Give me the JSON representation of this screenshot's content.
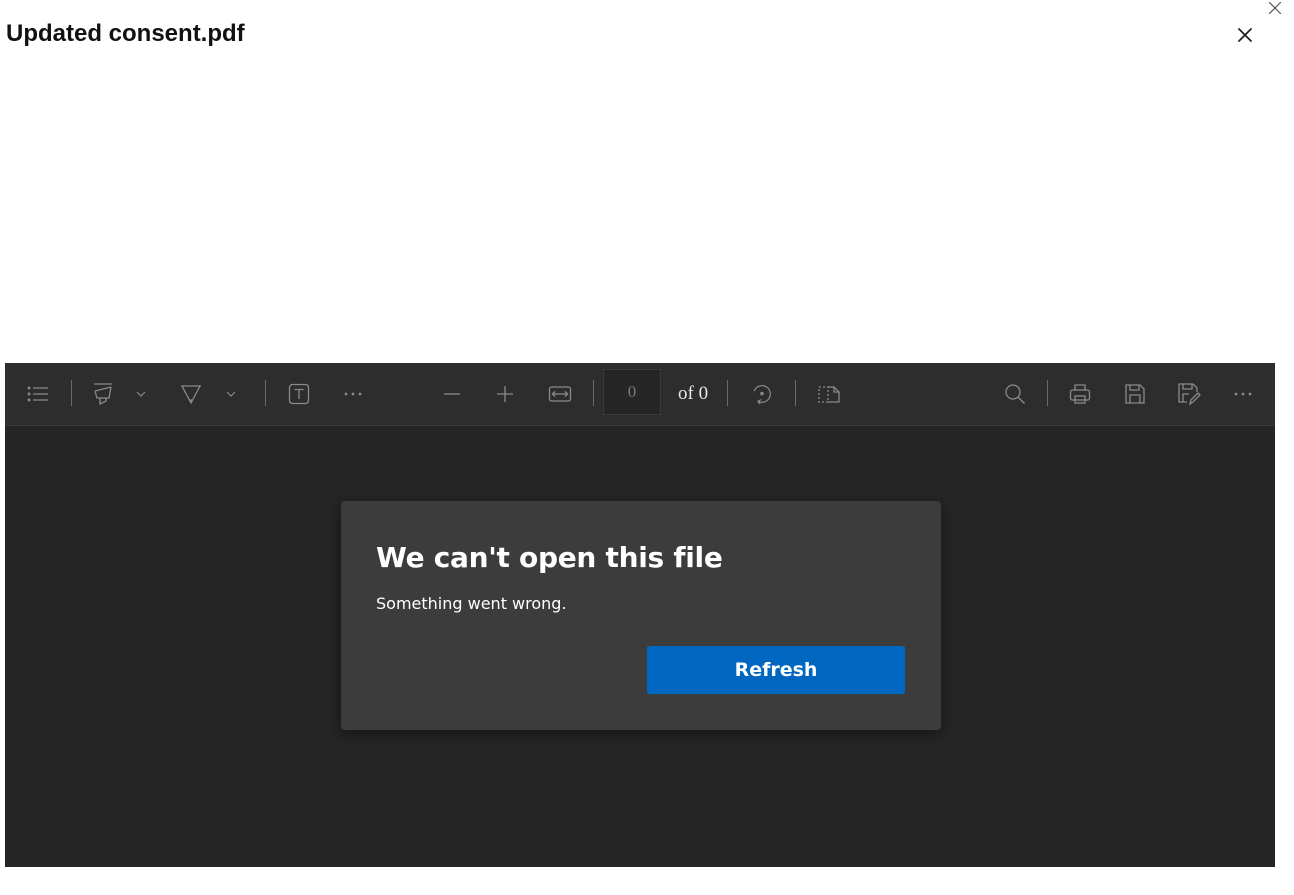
{
  "header": {
    "title": "Updated consent.pdf"
  },
  "toolbar": {
    "icons": [
      "table-of-contents-icon",
      "highlight-icon",
      "chevron-down-icon",
      "draw-icon",
      "chevron-down-icon",
      "add-text-icon",
      "more-icon",
      "zoom-out-icon",
      "zoom-in-icon",
      "fit-to-width-icon",
      "rotate-icon",
      "page-view-icon",
      "search-icon",
      "print-icon",
      "save-icon",
      "save-as-icon",
      "more-icon"
    ],
    "page_value": "0",
    "page_total": "of 0"
  },
  "dialog": {
    "title": "We can't open this file",
    "message": "Something went wrong.",
    "refresh_label": "Refresh"
  },
  "colors": {
    "viewer_background": "#262626",
    "toolbar_background": "#2d2d2d",
    "dialog_background": "#3c3c3c",
    "primary_button": "#0067c0",
    "icon": "#8a8a8a"
  }
}
